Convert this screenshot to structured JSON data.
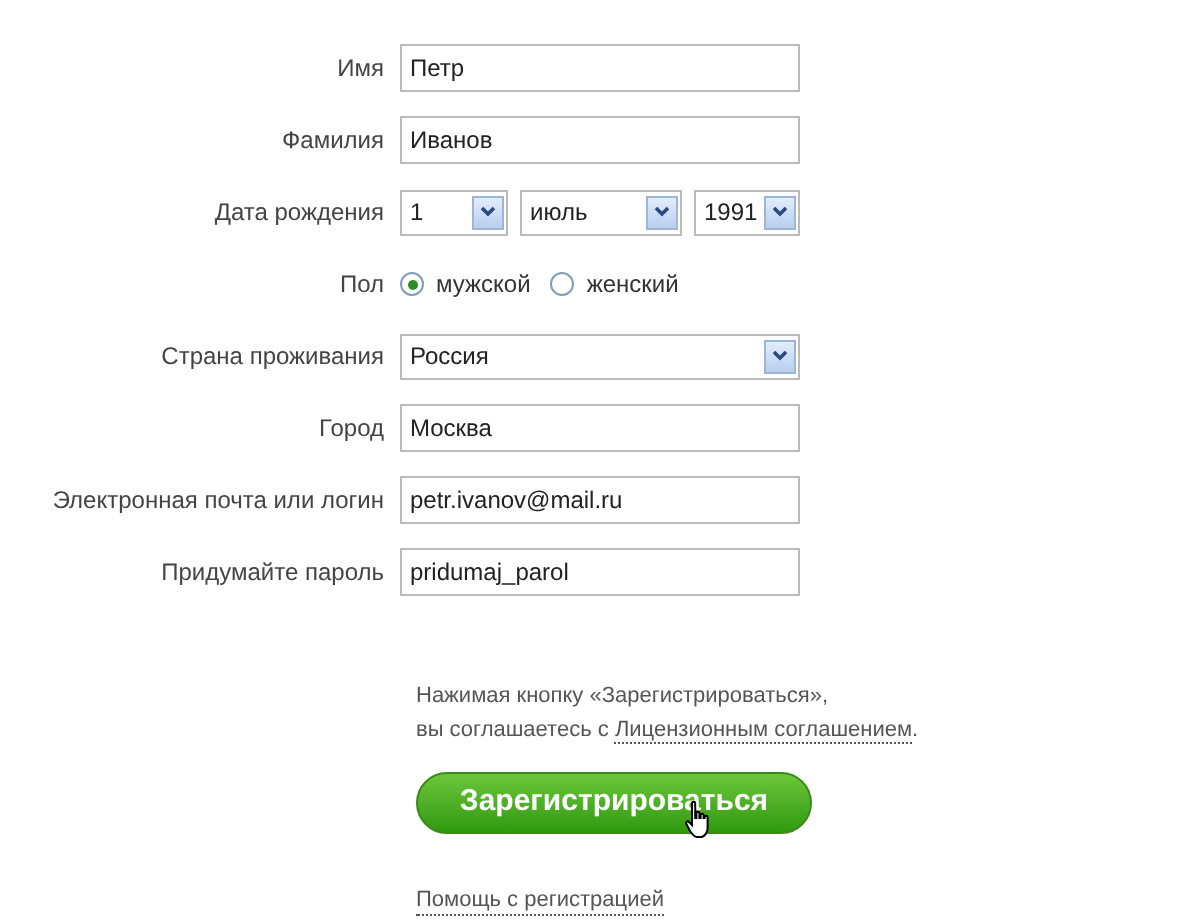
{
  "fields": [
    {
      "label": "Имя",
      "kind": "text",
      "value": "Петр"
    },
    {
      "label": "Фамилия",
      "kind": "text",
      "value": "Иванов"
    },
    {
      "label": "Дата рождения",
      "kind": "date",
      "selects": [
        {
          "value": "1"
        },
        {
          "value": "июль"
        },
        {
          "value": "1991"
        }
      ]
    },
    {
      "label": "Пол",
      "kind": "radio",
      "options": [
        {
          "label": "мужской",
          "selected": true
        },
        {
          "label": "женский",
          "selected": false
        }
      ]
    },
    {
      "label": "Страна проживания",
      "kind": "select",
      "value": "Россия"
    },
    {
      "label": "Город",
      "kind": "text",
      "value": "Москва"
    },
    {
      "label": "Электронная почта или логин",
      "kind": "text",
      "value": "petr.ivanov@mail.ru"
    },
    {
      "label": "Придумайте пароль",
      "kind": "text",
      "value": "pridumaj_parol"
    }
  ],
  "consent": {
    "line_1": "Нажимая кнопку «Зарегистрироваться»,",
    "line_2": "вы соглашаетесь с ",
    "link": "Лицензионным соглашением",
    "end": "."
  },
  "submit_button": "Зарегистрироваться",
  "help_link": "Помощь с регистрацией"
}
